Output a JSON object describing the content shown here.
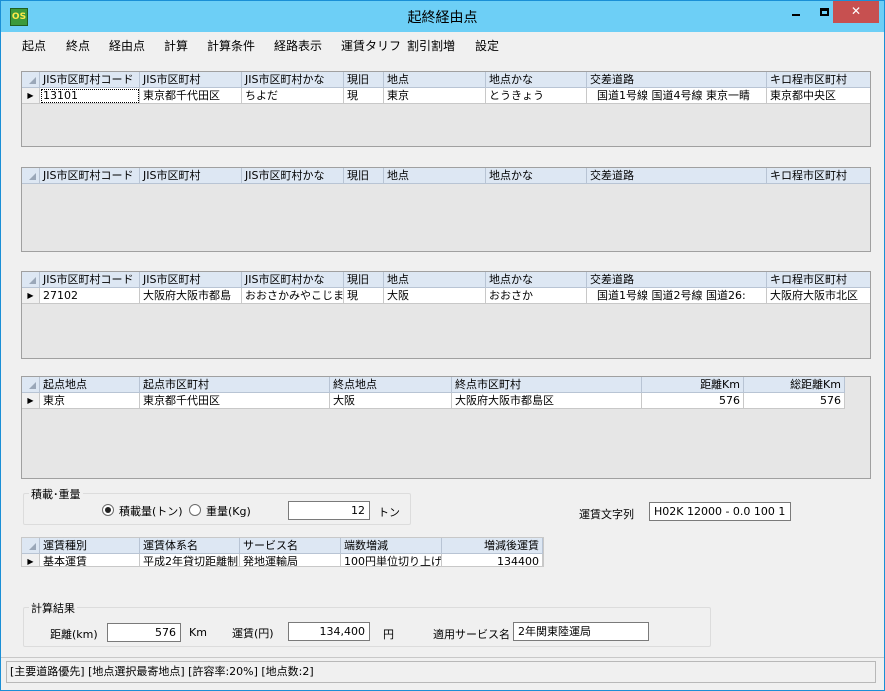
{
  "window": {
    "title": "起終経由点",
    "icon_label": "OS",
    "minimize": "_",
    "close": "✕"
  },
  "menu": [
    "起点",
    "終点",
    "経由点",
    "計算",
    "計算条件",
    "経路表示",
    "運賃タリフ",
    "割引割増",
    "設定"
  ],
  "point_columns": [
    "JIS市区町村コード",
    "JIS市区町村",
    "JIS市区町村かな",
    "現旧",
    "地点",
    "地点かな",
    "交差道路",
    "キロ程市区町村"
  ],
  "start_grid": {
    "rows": [
      [
        "13101",
        "東京都千代田区",
        "ちよだ",
        "現",
        "東京",
        "とうきょう",
        "国道1号線  国道4号線  東京一睛",
        "東京都中央区"
      ]
    ]
  },
  "via_grid": {
    "rows": []
  },
  "end_grid": {
    "rows": [
      [
        "27102",
        "大阪府大阪市都島",
        "おおさかみやこじま",
        "現",
        "大阪",
        "おおさか",
        "国道1号線  国道2号線  国道26:",
        "大阪府大阪市北区"
      ]
    ]
  },
  "route_grid": {
    "columns": [
      "起点地点",
      "起点市区町村",
      "終点地点",
      "終点市区町村",
      "距離Km",
      "総距離Km"
    ],
    "rows": [
      [
        "東京",
        "東京都千代田区",
        "大阪",
        "大阪府大阪市都島区",
        "576",
        "576"
      ]
    ]
  },
  "load": {
    "group_label": "積載･重量",
    "radio_capacity": "積載量(トン)",
    "radio_weight": "重量(Kg)",
    "selected": "capacity",
    "value": "12",
    "unit": "トン"
  },
  "fare_string": {
    "label": "運賃文字列",
    "value": "H02K 12000 - 0.0 100 1"
  },
  "fare_grid": {
    "columns": [
      "運賃種別",
      "運賃体系名",
      "サービス名",
      "端数増減",
      "増減後運賃"
    ],
    "rows": [
      [
        "基本運賃",
        "平成2年貸切距離制",
        "発地運輸局",
        "100円単位切り上げ",
        "134400"
      ]
    ]
  },
  "result": {
    "group_label": "計算結果",
    "distance_label": "距離(km)",
    "distance_value": "576",
    "distance_unit": "Km",
    "fare_label": "運賃(円)",
    "fare_value": "134,400",
    "fare_unit": "円",
    "service_label": "適用サービス名",
    "service_value": "2年関東陸運局"
  },
  "status": "[主要道路優先] [地点選択最寄地点] [許容率:20%] [地点数:2]",
  "colors": {
    "titlebar": "#6dcff6",
    "header_cell": "#dde7f3",
    "grid_background": "#e6e6e6",
    "close_button": "#c75050"
  }
}
